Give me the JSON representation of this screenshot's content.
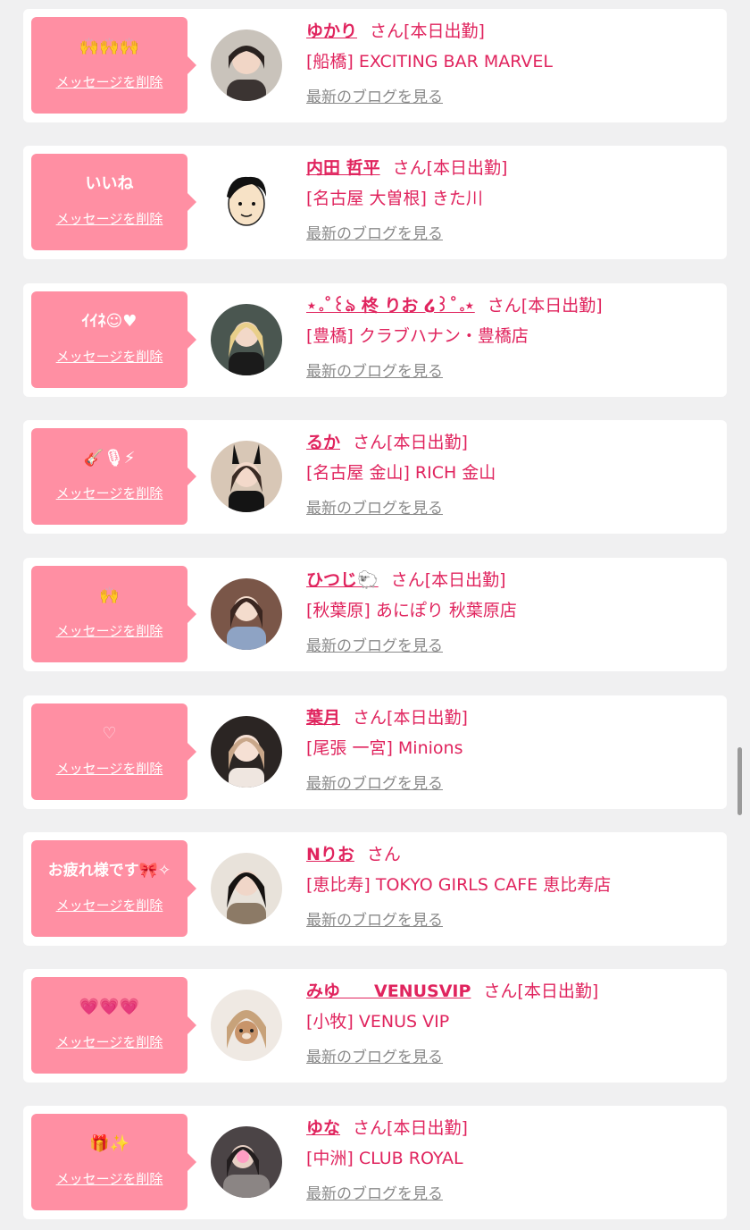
{
  "colors": {
    "accent": "#e0245e",
    "bubble": "#ff8fa3",
    "link_gray": "#8a8a8a"
  },
  "common": {
    "delete_label": "メッセージを削除",
    "blog_label": "最新のブログを見る",
    "san": "さん"
  },
  "items": [
    {
      "message": "🙌🙌🙌",
      "name": "ゆかり",
      "status": "[本日出勤]",
      "shop": "[船橋] EXCITING BAR MARVEL"
    },
    {
      "message": "いいね",
      "name": "内田 哲平",
      "status": "[本日出勤]",
      "shop": "[名古屋 大曽根] きた川"
    },
    {
      "message": "ｲｲﾈ☺︎♥",
      "name": "⋆｡˚꒰ঌ 柊 りお ໒꒱˚｡⋆",
      "status": "[本日出勤]",
      "shop": "[豊橋] クラブハナン・豊橋店"
    },
    {
      "message": "🎸🎙⚡",
      "name": "るか",
      "status": "[本日出勤]",
      "shop": "[名古屋 金山] RICH 金山"
    },
    {
      "message": "🙌",
      "name": "ひつじ🐑",
      "status": "[本日出勤]",
      "shop": "[秋葉原] あにぽり 秋葉原店"
    },
    {
      "message": "♡",
      "name": "葉月",
      "status": "[本日出勤]",
      "shop": "[尾張 一宮] Minions"
    },
    {
      "message": "お疲れ様です🎀✧",
      "name": "Nりお",
      "status": "",
      "shop": "[恵比寿] TOKYO GIRLS CAFE 恵比寿店"
    },
    {
      "message": "💗💗💗",
      "name": "みゆ　　VENUSVIP",
      "status": "[本日出勤]",
      "shop": "[小牧] VENUS VIP"
    },
    {
      "message": "🎁✨",
      "name": "ゆな",
      "status": "[本日出勤]",
      "shop": "[中洲] CLUB ROYAL"
    }
  ]
}
